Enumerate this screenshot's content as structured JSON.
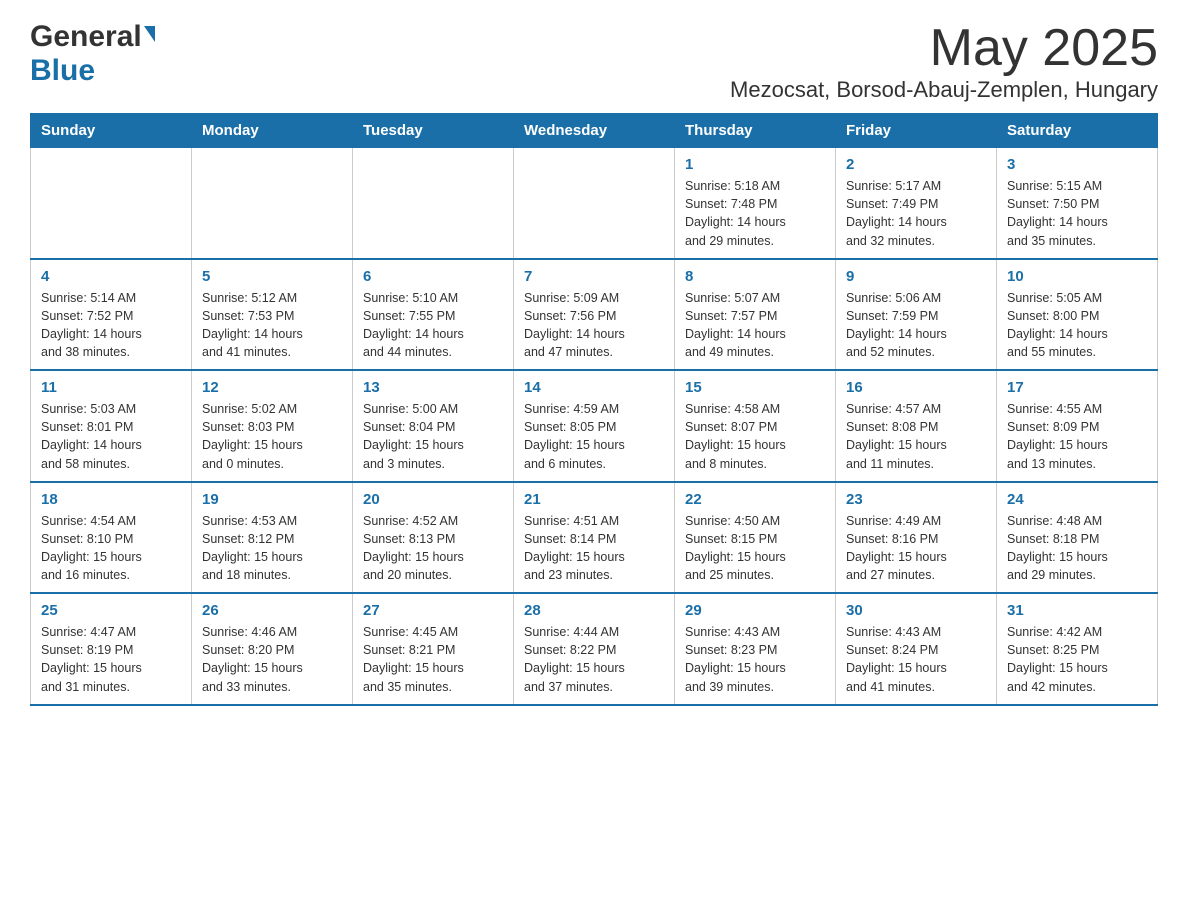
{
  "header": {
    "logo_general": "General",
    "logo_blue": "Blue",
    "title": "May 2025",
    "location": "Mezocsat, Borsod-Abauj-Zemplen, Hungary"
  },
  "weekdays": [
    "Sunday",
    "Monday",
    "Tuesday",
    "Wednesday",
    "Thursday",
    "Friday",
    "Saturday"
  ],
  "weeks": [
    [
      {
        "day": "",
        "info": ""
      },
      {
        "day": "",
        "info": ""
      },
      {
        "day": "",
        "info": ""
      },
      {
        "day": "",
        "info": ""
      },
      {
        "day": "1",
        "info": "Sunrise: 5:18 AM\nSunset: 7:48 PM\nDaylight: 14 hours\nand 29 minutes."
      },
      {
        "day": "2",
        "info": "Sunrise: 5:17 AM\nSunset: 7:49 PM\nDaylight: 14 hours\nand 32 minutes."
      },
      {
        "day": "3",
        "info": "Sunrise: 5:15 AM\nSunset: 7:50 PM\nDaylight: 14 hours\nand 35 minutes."
      }
    ],
    [
      {
        "day": "4",
        "info": "Sunrise: 5:14 AM\nSunset: 7:52 PM\nDaylight: 14 hours\nand 38 minutes."
      },
      {
        "day": "5",
        "info": "Sunrise: 5:12 AM\nSunset: 7:53 PM\nDaylight: 14 hours\nand 41 minutes."
      },
      {
        "day": "6",
        "info": "Sunrise: 5:10 AM\nSunset: 7:55 PM\nDaylight: 14 hours\nand 44 minutes."
      },
      {
        "day": "7",
        "info": "Sunrise: 5:09 AM\nSunset: 7:56 PM\nDaylight: 14 hours\nand 47 minutes."
      },
      {
        "day": "8",
        "info": "Sunrise: 5:07 AM\nSunset: 7:57 PM\nDaylight: 14 hours\nand 49 minutes."
      },
      {
        "day": "9",
        "info": "Sunrise: 5:06 AM\nSunset: 7:59 PM\nDaylight: 14 hours\nand 52 minutes."
      },
      {
        "day": "10",
        "info": "Sunrise: 5:05 AM\nSunset: 8:00 PM\nDaylight: 14 hours\nand 55 minutes."
      }
    ],
    [
      {
        "day": "11",
        "info": "Sunrise: 5:03 AM\nSunset: 8:01 PM\nDaylight: 14 hours\nand 58 minutes."
      },
      {
        "day": "12",
        "info": "Sunrise: 5:02 AM\nSunset: 8:03 PM\nDaylight: 15 hours\nand 0 minutes."
      },
      {
        "day": "13",
        "info": "Sunrise: 5:00 AM\nSunset: 8:04 PM\nDaylight: 15 hours\nand 3 minutes."
      },
      {
        "day": "14",
        "info": "Sunrise: 4:59 AM\nSunset: 8:05 PM\nDaylight: 15 hours\nand 6 minutes."
      },
      {
        "day": "15",
        "info": "Sunrise: 4:58 AM\nSunset: 8:07 PM\nDaylight: 15 hours\nand 8 minutes."
      },
      {
        "day": "16",
        "info": "Sunrise: 4:57 AM\nSunset: 8:08 PM\nDaylight: 15 hours\nand 11 minutes."
      },
      {
        "day": "17",
        "info": "Sunrise: 4:55 AM\nSunset: 8:09 PM\nDaylight: 15 hours\nand 13 minutes."
      }
    ],
    [
      {
        "day": "18",
        "info": "Sunrise: 4:54 AM\nSunset: 8:10 PM\nDaylight: 15 hours\nand 16 minutes."
      },
      {
        "day": "19",
        "info": "Sunrise: 4:53 AM\nSunset: 8:12 PM\nDaylight: 15 hours\nand 18 minutes."
      },
      {
        "day": "20",
        "info": "Sunrise: 4:52 AM\nSunset: 8:13 PM\nDaylight: 15 hours\nand 20 minutes."
      },
      {
        "day": "21",
        "info": "Sunrise: 4:51 AM\nSunset: 8:14 PM\nDaylight: 15 hours\nand 23 minutes."
      },
      {
        "day": "22",
        "info": "Sunrise: 4:50 AM\nSunset: 8:15 PM\nDaylight: 15 hours\nand 25 minutes."
      },
      {
        "day": "23",
        "info": "Sunrise: 4:49 AM\nSunset: 8:16 PM\nDaylight: 15 hours\nand 27 minutes."
      },
      {
        "day": "24",
        "info": "Sunrise: 4:48 AM\nSunset: 8:18 PM\nDaylight: 15 hours\nand 29 minutes."
      }
    ],
    [
      {
        "day": "25",
        "info": "Sunrise: 4:47 AM\nSunset: 8:19 PM\nDaylight: 15 hours\nand 31 minutes."
      },
      {
        "day": "26",
        "info": "Sunrise: 4:46 AM\nSunset: 8:20 PM\nDaylight: 15 hours\nand 33 minutes."
      },
      {
        "day": "27",
        "info": "Sunrise: 4:45 AM\nSunset: 8:21 PM\nDaylight: 15 hours\nand 35 minutes."
      },
      {
        "day": "28",
        "info": "Sunrise: 4:44 AM\nSunset: 8:22 PM\nDaylight: 15 hours\nand 37 minutes."
      },
      {
        "day": "29",
        "info": "Sunrise: 4:43 AM\nSunset: 8:23 PM\nDaylight: 15 hours\nand 39 minutes."
      },
      {
        "day": "30",
        "info": "Sunrise: 4:43 AM\nSunset: 8:24 PM\nDaylight: 15 hours\nand 41 minutes."
      },
      {
        "day": "31",
        "info": "Sunrise: 4:42 AM\nSunset: 8:25 PM\nDaylight: 15 hours\nand 42 minutes."
      }
    ]
  ]
}
